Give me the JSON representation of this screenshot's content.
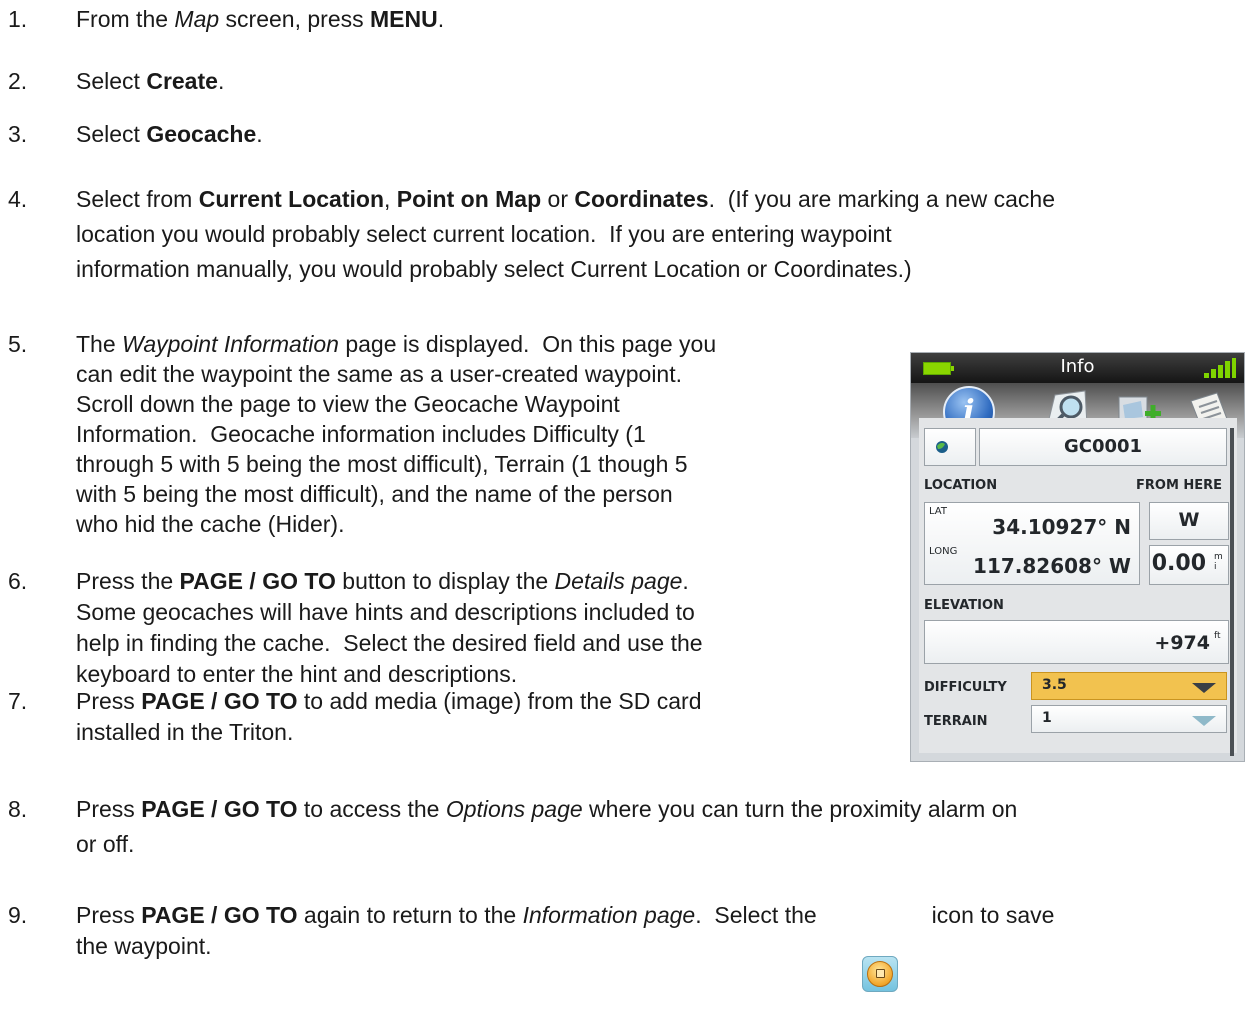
{
  "steps": [
    {
      "num": "1.",
      "lines": [
        [
          {
            "t": "From the "
          },
          {
            "t": "Map",
            "s": "i"
          },
          {
            "t": " screen, press "
          },
          {
            "t": "MENU",
            "s": "b"
          },
          {
            "t": "."
          }
        ]
      ]
    },
    {
      "num": "2.",
      "lines": [
        [
          {
            "t": "Select "
          },
          {
            "t": "Create",
            "s": "b"
          },
          {
            "t": "."
          }
        ]
      ]
    },
    {
      "num": "3.",
      "lines": [
        [
          {
            "t": "Select "
          },
          {
            "t": "Geocache",
            "s": "b"
          },
          {
            "t": "."
          }
        ]
      ]
    },
    {
      "num": "4.",
      "lines": [
        [
          {
            "t": "Select from "
          },
          {
            "t": "Current Location",
            "s": "b"
          },
          {
            "t": ", "
          },
          {
            "t": "Point on Map",
            "s": "b"
          },
          {
            "t": " or "
          },
          {
            "t": "Coordinates",
            "s": "b"
          },
          {
            "t": ".  (If you are marking a new cache"
          }
        ],
        [
          {
            "t": "location you would probably select current location.  If you are entering waypoint"
          }
        ],
        [
          {
            "t": "information manually, you would probably select Current Location or Coordinates.)"
          }
        ]
      ]
    },
    {
      "num": "5.",
      "lines": [
        [
          {
            "t": "The "
          },
          {
            "t": "Waypoint Information",
            "s": "i"
          },
          {
            "t": " page is displayed.  On this page you"
          }
        ],
        [
          {
            "t": "can edit the waypoint the same as a user-created waypoint."
          }
        ],
        [
          {
            "t": "Scroll down the page to view the Geocache Waypoint"
          }
        ],
        [
          {
            "t": "Information.  Geocache information includes Difficulty (1"
          }
        ],
        [
          {
            "t": "through 5 with 5 being the most difficult), Terrain (1 though 5"
          }
        ],
        [
          {
            "t": "with 5 being the most difficult), and the name of the person"
          }
        ],
        [
          {
            "t": "who hid the cache (Hider)."
          }
        ]
      ]
    },
    {
      "num": "6.",
      "lines": [
        [
          {
            "t": "Press the "
          },
          {
            "t": "PAGE / GO TO",
            "s": "b"
          },
          {
            "t": " button to display the "
          },
          {
            "t": "Details page",
            "s": "i"
          },
          {
            "t": "."
          }
        ],
        [
          {
            "t": "Some geocaches will have hints and descriptions included to"
          }
        ],
        [
          {
            "t": "help in finding the cache.  Select the desired field and use the"
          }
        ],
        [
          {
            "t": "keyboard to enter the hint and descriptions."
          }
        ]
      ]
    },
    {
      "num": "7.",
      "lines": [
        [
          {
            "t": "Press "
          },
          {
            "t": "PAGE / GO TO",
            "s": "b"
          },
          {
            "t": " to add media (image) from the SD card"
          }
        ],
        [
          {
            "t": "installed in the Triton."
          }
        ]
      ]
    },
    {
      "num": "8.",
      "lines": [
        [
          {
            "t": "Press "
          },
          {
            "t": "PAGE / GO TO",
            "s": "b"
          },
          {
            "t": " to access the "
          },
          {
            "t": "Options page",
            "s": "i"
          },
          {
            "t": " where you can turn the proximity alarm on"
          }
        ],
        [
          {
            "t": "or off."
          }
        ]
      ]
    },
    {
      "num": "9.",
      "lines": [
        [
          {
            "t": "Press "
          },
          {
            "t": "PAGE / GO TO",
            "s": "b"
          },
          {
            "t": " again to return to the "
          },
          {
            "t": "Information page",
            "s": "i"
          },
          {
            "t": ".  Select the                  icon to save"
          }
        ],
        [
          {
            "t": "the waypoint."
          }
        ]
      ]
    }
  ],
  "device": {
    "title": "Info",
    "waypoint_name": "GC0001",
    "location_label": "LOCATION",
    "from_here_label": "FROM HERE",
    "lat_label": "LAT",
    "lat_value": "34.10927° N",
    "long_label": "LONG",
    "long_value": "117.82608° W",
    "direction": "W",
    "distance": "0.00",
    "distance_unit": "mi",
    "elevation_label": "ELEVATION",
    "elevation_value": "+974",
    "elevation_unit": "ft",
    "difficulty_label": "DIFFICULTY",
    "difficulty_value": "3.5",
    "terrain_label": "TERRAIN",
    "terrain_value": "1",
    "colors": {
      "battery": "#8ad600",
      "difficulty_field": "#f2c24f",
      "info_tab": "#2f6bc0"
    }
  },
  "icons": {
    "save": "save-icon",
    "globe": "globe-icon",
    "search_tab": "search-tab-icon",
    "media_tab": "media-add-tab-icon",
    "notes_tab": "notes-tab-icon"
  }
}
